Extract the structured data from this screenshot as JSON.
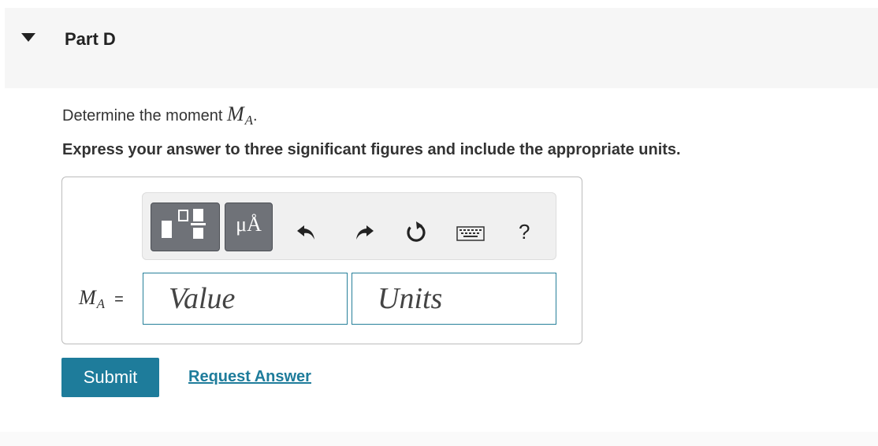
{
  "part": {
    "title": "Part D"
  },
  "question": {
    "text": "Determine the moment",
    "math_main": "M",
    "math_sub": "A",
    "trailing": "."
  },
  "instructions": "Express your answer to three significant figures and include the appropriate units.",
  "toolbar": {
    "units_symbol": "μÅ",
    "help_label": "?",
    "icons": [
      "templates-icon",
      "units-icon",
      "undo-icon",
      "redo-icon",
      "reset-icon",
      "keyboard-icon",
      "help-icon"
    ]
  },
  "answer": {
    "label_main": "M",
    "label_sub": "A",
    "equals": "=",
    "value_placeholder": "Value",
    "units_placeholder": "Units"
  },
  "actions": {
    "submit_label": "Submit",
    "request_label": "Request Answer"
  },
  "colors": {
    "accent": "#1e7c9b",
    "header_bg": "#f6f6f6",
    "toolbar_button": "#6f7278"
  }
}
